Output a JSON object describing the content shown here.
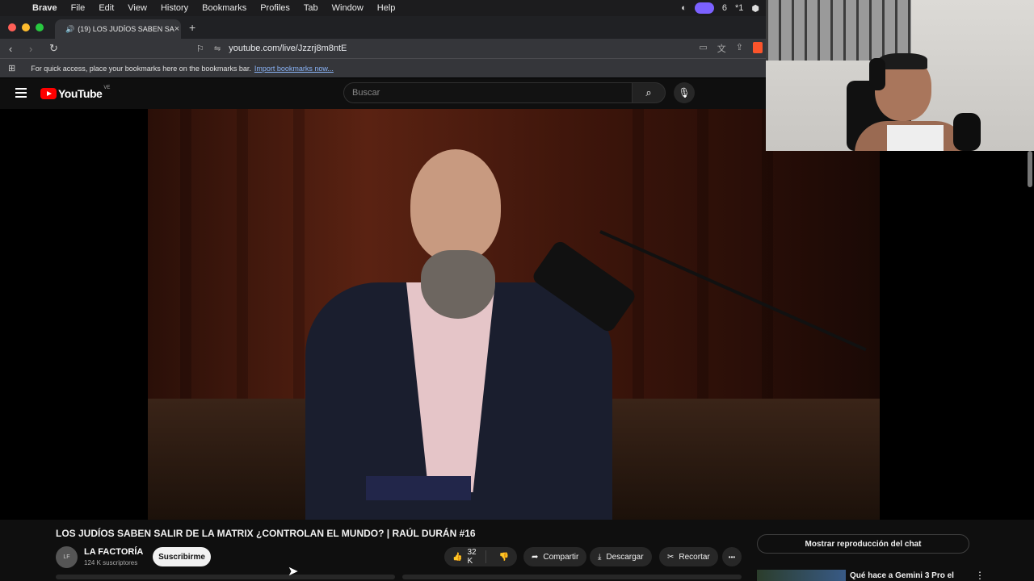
{
  "menubar": {
    "apple": "",
    "items": [
      "Brave",
      "File",
      "Edit",
      "View",
      "History",
      "Bookmarks",
      "Profiles",
      "Tab",
      "Window",
      "Help"
    ],
    "status_number": "6",
    "status_extra": "*1"
  },
  "browser": {
    "tab_title": "(19) LOS JUDÍOS SABEN SA",
    "tab_close": "×",
    "new_tab": "+",
    "url": "youtube.com/live/Jzzrj8m8ntE",
    "bookmarks_prompt": "For quick access, place your bookmarks here on the bookmarks bar.",
    "import_link": "Import bookmarks now..."
  },
  "youtube": {
    "logo_text": "YouTube",
    "country": "VE",
    "search_placeholder": "Buscar"
  },
  "video": {
    "title": "LOS JUDÍOS SABEN SALIR DE LA MATRIX ¿CONTROLAN EL MUNDO? | RAÚL DURÁN #16",
    "channel": "LA FACTORÍA",
    "subscribers": "124 K suscriptores",
    "subscribe_label": "Suscribirme",
    "likes": "32 K",
    "share_label": "Compartir",
    "download_label": "Descargar",
    "clip_label": "Recortar",
    "more_label": "•••"
  },
  "sidebar": {
    "chat_button": "Mostrar reproducción del chat",
    "rec_title": "Qué hace a Gemini 3 Pro el"
  },
  "colors": {
    "yt_red": "#ff0000",
    "brand_purple": "#7b61ff"
  }
}
